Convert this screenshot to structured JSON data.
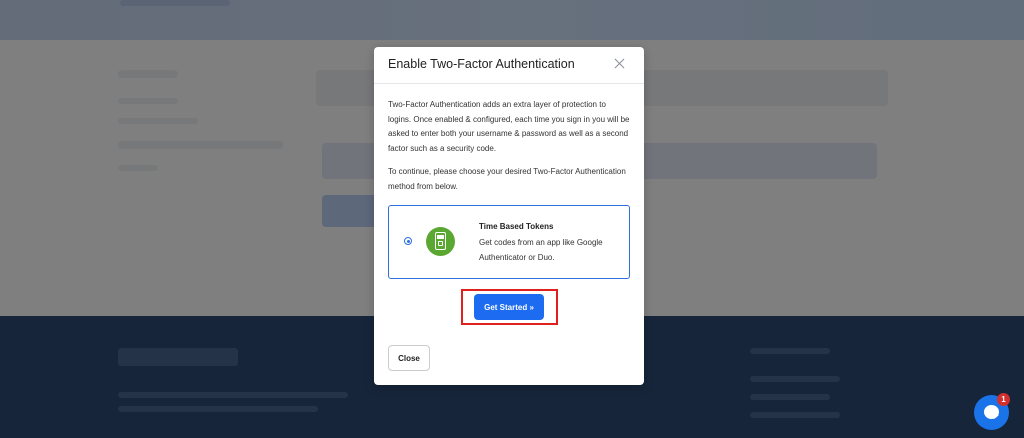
{
  "modal": {
    "title": "Enable Two-Factor Authentication",
    "intro": "Two-Factor Authentication adds an extra layer of protection to logins. Once enabled & configured, each time you sign in you will be asked to enter both your username & password as well as a second factor such as a security code.",
    "instruction": "To continue, please choose your desired Two-Factor Authentication method from below.",
    "option": {
      "title": "Time Based Tokens",
      "description": "Get codes from an app like Google Authenticator or Duo.",
      "selected": true,
      "icon": "phone-lock-icon"
    },
    "primary_button": "Get Started »",
    "close_button": "Close"
  },
  "chat": {
    "badge": "1"
  },
  "colors": {
    "accent": "#1c6bf0",
    "highlight": "#e0201c",
    "icon_bg": "#5aa831",
    "overlay": "rgba(0,0,0,0.5)"
  }
}
